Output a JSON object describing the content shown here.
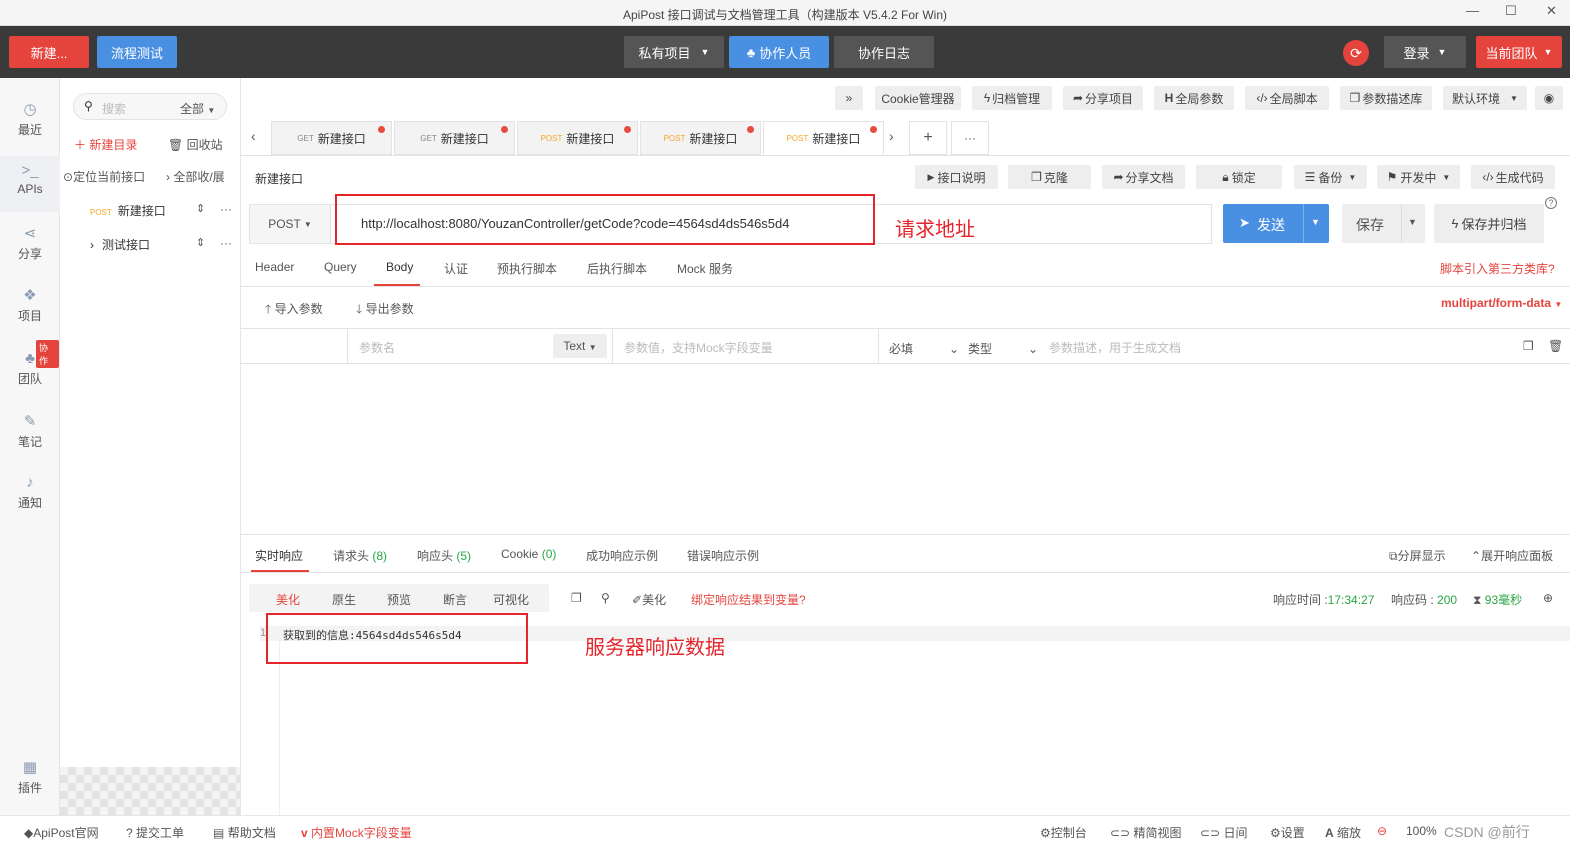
{
  "window": {
    "title": "ApiPost 接口调试与文档管理工具（构建版本 V5.4.2 For Win)",
    "min": "—",
    "max": "☐",
    "close": "✕"
  },
  "topbar": {
    "new_label": "新建...",
    "flow_label": "流程测试",
    "private_project": "私有项目",
    "collaborators": "协作人员",
    "collab_log": "协作日志",
    "login": "登录",
    "current_team": "当前团队"
  },
  "sidebar": {
    "items": [
      {
        "label": "最近",
        "icon": "clock-icon"
      },
      {
        "label": "APIs",
        "icon": "terminal-icon"
      },
      {
        "label": "分享",
        "icon": "share-icon"
      },
      {
        "label": "项目",
        "icon": "cubes-icon"
      },
      {
        "label": "团队",
        "icon": "team-icon",
        "badge": "协作"
      },
      {
        "label": "笔记",
        "icon": "edit-icon"
      },
      {
        "label": "通知",
        "icon": "bell-icon"
      }
    ],
    "plugins": "插件"
  },
  "tree": {
    "search_placeholder": "搜索",
    "filter": "全部",
    "new_dir": "新建目录",
    "recycle": "回收站",
    "locate": "定位当前接口",
    "collapse": "全部收/展",
    "items": [
      {
        "method": "POST",
        "label": "新建接口"
      },
      {
        "label": "测试接口"
      }
    ]
  },
  "toolbar": {
    "expand": "»",
    "cookie": "Cookie管理器",
    "archive": "归档管理",
    "share_project": "分享项目",
    "global_params": "全局参数",
    "global_script": "全局脚本",
    "param_lib": "参数描述库",
    "env": "默认环境"
  },
  "tabs": [
    {
      "method": "GET",
      "label": "新建接口"
    },
    {
      "method": "GET",
      "label": "新建接口"
    },
    {
      "method": "POST",
      "label": "新建接口"
    },
    {
      "method": "POST",
      "label": "新建接口"
    },
    {
      "method": "POST",
      "label": "新建接口"
    }
  ],
  "tab_controls": {
    "prev": "‹",
    "next": "›",
    "add": "+",
    "more": "···"
  },
  "request": {
    "name": "新建接口",
    "doc": "接口说明",
    "clone": "克隆",
    "share_doc": "分享文档",
    "lock": "锁定",
    "backup": "备份",
    "dev": "开发中",
    "gen_code": "生成代码",
    "method": "POST",
    "url": "http://localhost:8080/YouzanController/getCode?code=4564sd4ds546s5d4",
    "send": "发送",
    "save": "保存",
    "save_archive": "保存并归档",
    "help": "?"
  },
  "annotations": {
    "url": "请求地址",
    "response": "服务器响应数据"
  },
  "subtabs": [
    "Header",
    "Query",
    "Body",
    "认证",
    "预执行脚本",
    "后执行脚本",
    "Mock 服务"
  ],
  "third_party": "脚本引入第三方类库?",
  "body": {
    "import": "导入参数",
    "export": "导出参数",
    "content_type": "multipart/form-data",
    "param_name_placeholder": "参数名",
    "type": "Text",
    "value_placeholder": "参数值，支持Mock字段变量",
    "required": "必填",
    "type_label": "类型",
    "desc_placeholder": "参数描述，用于生成文档"
  },
  "response": {
    "tabs": [
      "实时响应",
      "请求头",
      "响应头",
      "Cookie",
      "成功响应示例",
      "错误响应示例"
    ],
    "tab_counts": {
      "req_headers": "(8)",
      "resp_headers": "(5)",
      "cookie": "(0)"
    },
    "split": "分屏显示",
    "expand": "展开响应面板",
    "views": [
      "美化",
      "原生",
      "预览",
      "断言",
      "可视化"
    ],
    "beautify": "美化",
    "bind": "绑定响应结果到变量?",
    "time_label": "响应时间 :",
    "time": "17:34:27",
    "code_label": "响应码 :",
    "code": "200",
    "duration": "93毫秒",
    "line_no": "1",
    "content": "获取到的信息:4564sd4ds546s5d4"
  },
  "statusbar": {
    "official": "ApiPost官网",
    "ticket": "提交工单",
    "help": "帮助文档",
    "mock": "内置Mock字段变量",
    "console": "控制台",
    "simple": "精简视图",
    "day": "日间",
    "settings": "设置",
    "zoom": "缩放",
    "zoom_value": "100%",
    "watermark": "CSDN @前行"
  }
}
